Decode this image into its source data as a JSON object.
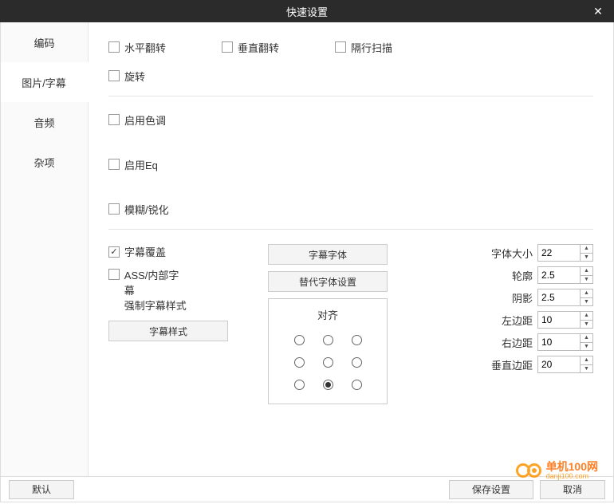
{
  "title": "快速设置",
  "tabs": [
    "编码",
    "图片/字幕",
    "音频",
    "杂项"
  ],
  "activeTab": 1,
  "checks": {
    "hflip": "水平翻转",
    "vflip": "垂直翻转",
    "interlace": "隔行扫描",
    "rotate": "旋转",
    "hue": "启用色调",
    "eq": "启用Eq",
    "blur": "模糊/锐化",
    "subOverride": "字幕覆盖",
    "forceStyle1": "ASS/内部字幕",
    "forceStyle2": "强制字幕样式"
  },
  "buttons": {
    "subStyle": "字幕样式",
    "subFont": "字幕字体",
    "altFont": "替代字体设置",
    "alignTitle": "对齐",
    "default": "默认",
    "save": "保存设置",
    "cancel": "取消"
  },
  "fields": {
    "fontSize": {
      "label": "字体大小",
      "value": "22"
    },
    "outline": {
      "label": "轮廓",
      "value": "2.5"
    },
    "shadow": {
      "label": "阴影",
      "value": "2.5"
    },
    "marginL": {
      "label": "左边距",
      "value": "10"
    },
    "marginR": {
      "label": "右边距",
      "value": "10"
    },
    "marginV": {
      "label": "垂直边距",
      "value": "20"
    }
  },
  "alignSelected": 7,
  "watermark": {
    "name": "单机100网",
    "url": "danji100.com"
  }
}
